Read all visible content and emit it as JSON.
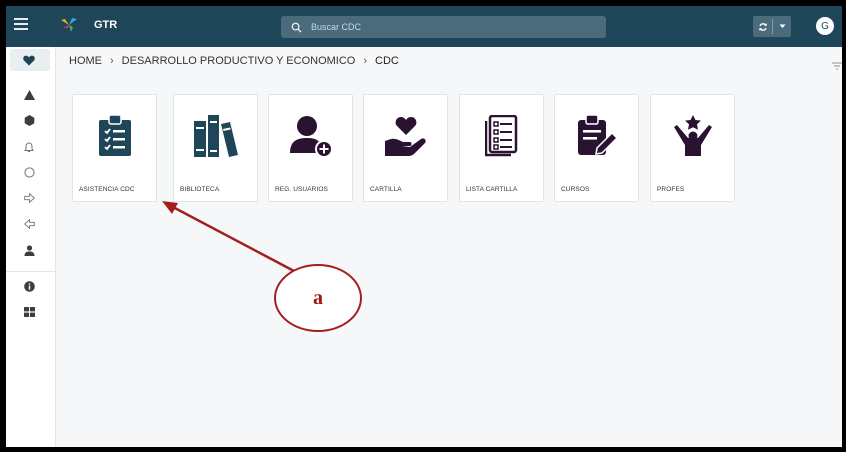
{
  "app": {
    "title": "GTR"
  },
  "search": {
    "placeholder": "Buscar CDC",
    "value": ""
  },
  "user": {
    "initial": "G"
  },
  "breadcrumb": [
    {
      "label": "HOME"
    },
    {
      "label": "DESARROLLO PRODUCTIVO Y ECONOMICO"
    },
    {
      "label": "CDC"
    }
  ],
  "sidebar": {
    "items": [
      {
        "icon": "heart-icon"
      },
      {
        "icon": "triangle-icon"
      },
      {
        "icon": "hexagon-icon"
      },
      {
        "icon": "bell-icon"
      },
      {
        "icon": "circle-icon"
      },
      {
        "icon": "arrow-right-icon"
      },
      {
        "icon": "arrow-left-icon"
      },
      {
        "icon": "user-icon"
      },
      {
        "icon": "info-icon"
      },
      {
        "icon": "grid-icon"
      }
    ]
  },
  "tiles": [
    {
      "label": "ASISTENCIA CDC",
      "icon": "clipboard-checklist-icon"
    },
    {
      "label": "BIBLIOTECA",
      "icon": "books-icon"
    },
    {
      "label": "REG. USUARIOS",
      "icon": "user-add-icon"
    },
    {
      "label": "CARTILLA",
      "icon": "hand-heart-icon"
    },
    {
      "label": "LISTA CARTILLA",
      "icon": "checklist-document-icon"
    },
    {
      "label": "CURSOS",
      "icon": "clipboard-pen-icon"
    },
    {
      "label": "PROFES",
      "icon": "person-star-icon"
    }
  ],
  "annotation": {
    "label": "a"
  },
  "colors": {
    "topbar": "#1f4658",
    "tile_icon_dark_teal": "#1f4658",
    "tile_icon_purple": "#2a1231",
    "annotation_red": "#a31f1f"
  }
}
